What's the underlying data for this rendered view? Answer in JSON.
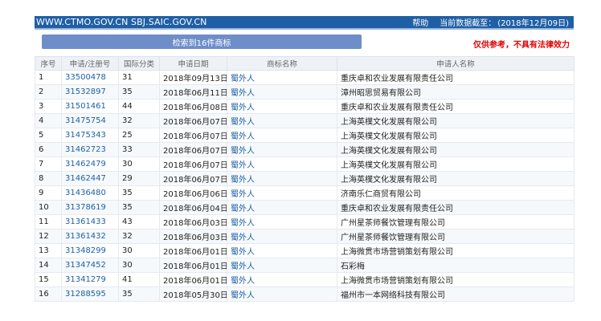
{
  "header": {
    "site": "WWW.CTMO.GOV.CN SBJ.SAIC.GOV.CN",
    "help": "帮助",
    "date_label": "当前数据截至：",
    "date_value": "(2018年12月09日)"
  },
  "results_label": "检索到16件商标",
  "disclaimer": "仅供参考，不具有法律效力",
  "columns": [
    "序号",
    "申请/注册号",
    "国际分类",
    "申请日期",
    "商标名称",
    "申请人名称"
  ],
  "rows": [
    {
      "no": "1",
      "reg": "33500478",
      "cls": "31",
      "date": "2018年09月13日",
      "name": "蜀外人",
      "applicant": "重庆卓和农业发展有限责任公司"
    },
    {
      "no": "2",
      "reg": "31532897",
      "cls": "35",
      "date": "2018年06月11日",
      "name": "蜀外人",
      "applicant": "漳州昭思贸易有限公司"
    },
    {
      "no": "3",
      "reg": "31501461",
      "cls": "44",
      "date": "2018年06月08日",
      "name": "蜀外人",
      "applicant": "重庆卓和农业发展有限责任公司"
    },
    {
      "no": "4",
      "reg": "31475754",
      "cls": "32",
      "date": "2018年06月07日",
      "name": "蜀外人",
      "applicant": "上海英樸文化发展有限公司"
    },
    {
      "no": "5",
      "reg": "31475343",
      "cls": "25",
      "date": "2018年06月07日",
      "name": "蜀外人",
      "applicant": "上海英樸文化发展有限公司"
    },
    {
      "no": "6",
      "reg": "31462723",
      "cls": "33",
      "date": "2018年06月07日",
      "name": "蜀外人",
      "applicant": "上海英樸文化发展有限公司"
    },
    {
      "no": "7",
      "reg": "31462479",
      "cls": "30",
      "date": "2018年06月07日",
      "name": "蜀外人",
      "applicant": "上海英樸文化发展有限公司"
    },
    {
      "no": "8",
      "reg": "31462447",
      "cls": "29",
      "date": "2018年06月07日",
      "name": "蜀外人",
      "applicant": "上海英樸文化发展有限公司"
    },
    {
      "no": "9",
      "reg": "31436480",
      "cls": "35",
      "date": "2018年06月06日",
      "name": "蜀外人",
      "applicant": "济南乐仁商贸有限公司"
    },
    {
      "no": "10",
      "reg": "31378619",
      "cls": "35",
      "date": "2018年06月04日",
      "name": "蜀外人",
      "applicant": "重庆卓和农业发展有限责任公司"
    },
    {
      "no": "11",
      "reg": "31361433",
      "cls": "43",
      "date": "2018年06月03日",
      "name": "蜀外人",
      "applicant": "广州星茶师餐饮管理有限公司"
    },
    {
      "no": "12",
      "reg": "31361432",
      "cls": "32",
      "date": "2018年06月03日",
      "name": "蜀外人",
      "applicant": "广州星茶师餐饮管理有限公司"
    },
    {
      "no": "13",
      "reg": "31348299",
      "cls": "30",
      "date": "2018年06月01日",
      "name": "蜀外人",
      "applicant": "上海微贯市场营销策划有限公司"
    },
    {
      "no": "14",
      "reg": "31347452",
      "cls": "30",
      "date": "2018年06月01日",
      "name": "蜀外人",
      "applicant": "石彩梅"
    },
    {
      "no": "15",
      "reg": "31341279",
      "cls": "41",
      "date": "2018年06月01日",
      "name": "蜀外人",
      "applicant": "上海微贯市场营销策划有限公司"
    },
    {
      "no": "16",
      "reg": "31288595",
      "cls": "35",
      "date": "2018年05月30日",
      "name": "蜀外人",
      "applicant": "福州市一本网络科技有限公司"
    }
  ]
}
